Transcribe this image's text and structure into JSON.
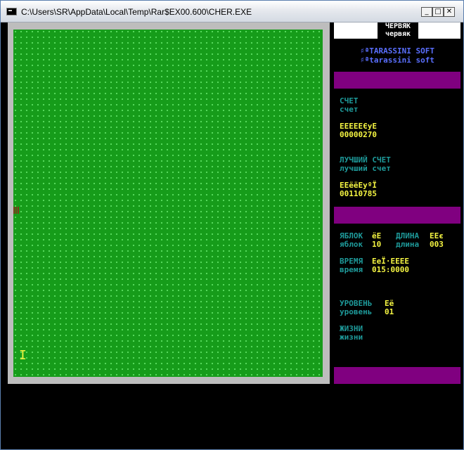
{
  "window": {
    "title": "C:\\Users\\SR\\AppData\\Local\\Temp\\Rar$EX00.600\\CHER.EXE",
    "minimize_glyph": "_",
    "maximize_glyph": "□",
    "close_glyph": "✕"
  },
  "game": {
    "title_upper": "ЧЕРВЯК",
    "title_lower": "червяк",
    "brand_upper": "♯ªTARASSINI SOFT",
    "brand_lower": "♯ªtarassini soft",
    "score": {
      "label_upper": "СЧЕТ",
      "label_lower": "счет",
      "value_garbled": "ЕЕЕЕЕЄуЕ",
      "value": "00000270"
    },
    "best_score": {
      "label_upper": "ЛУЧШИЙ СЧЕТ",
      "label_lower": "лучший счет",
      "value_garbled": "ЕЕёёЕуºЇ",
      "value": "00110785"
    },
    "apples": {
      "label_upper": "ЯБЛОК",
      "value_garbled": "ёЕ",
      "label_lower": "яблок",
      "value": "10"
    },
    "length": {
      "label_upper": "ДЛИНА",
      "value_garbled": "ЕЕє",
      "label_lower": "длина",
      "value": "003"
    },
    "time": {
      "label_upper": "ВРЕМЯ",
      "value_garbled": "ЕеЇ·ЕЕЕЕ",
      "label_lower": "время",
      "value": "015:0000"
    },
    "level": {
      "label_upper": "УРОВЕНЬ",
      "value_garbled": "Её",
      "label_lower": "уровень",
      "value": "01"
    },
    "lives": {
      "label_upper": "ЖИЗНИ",
      "label_lower": "жизни"
    },
    "snake_glyph": "#",
    "cursor_glyph": "I"
  },
  "colors": {
    "board_green": "#169c1a",
    "bar_purple": "#800080",
    "text_cyan": "#1e9a9a",
    "text_yellow": "#f5f542",
    "brand_blue": "#5a6fff"
  }
}
